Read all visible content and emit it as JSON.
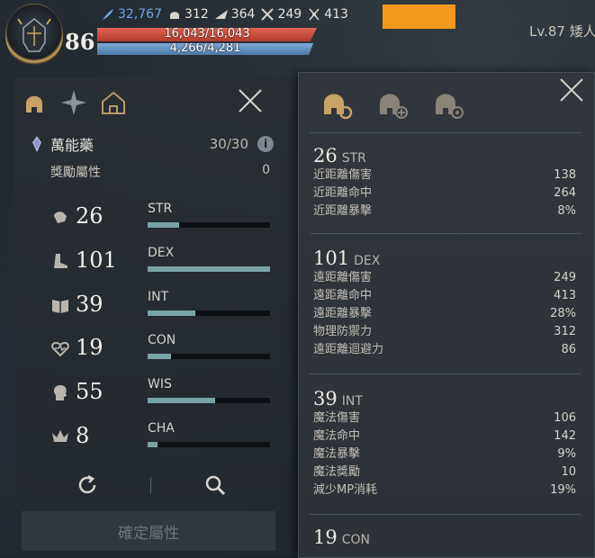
{
  "hud": {
    "level": "86",
    "stats": [
      {
        "icon": "feather-icon",
        "value": "32,767",
        "color": "#6fa8e8"
      },
      {
        "icon": "helmet-icon",
        "value": "312",
        "color": "#e8e4dc"
      },
      {
        "icon": "wing-icon",
        "value": "364",
        "color": "#e8e4dc"
      },
      {
        "icon": "crossed-swords-icon",
        "value": "249",
        "color": "#e8e4dc"
      },
      {
        "icon": "crossed-blades-icon",
        "value": "413",
        "color": "#e8e4dc"
      }
    ],
    "hp": "16,043/16,043",
    "mp": "4,266/4,281",
    "target_level": "Lv.87 矮人"
  },
  "left": {
    "potion": {
      "name": "萬能藥",
      "count": "30/30"
    },
    "bonus": {
      "label": "獎勵屬性",
      "value": "0"
    },
    "attributes": [
      {
        "key": "STR",
        "value": "26",
        "icon": "fist-icon",
        "fill": 0.26
      },
      {
        "key": "DEX",
        "value": "101",
        "icon": "boot-icon",
        "fill": 1.0
      },
      {
        "key": "INT",
        "value": "39",
        "icon": "book-icon",
        "fill": 0.39
      },
      {
        "key": "CON",
        "value": "19",
        "icon": "heart-icon",
        "fill": 0.19
      },
      {
        "key": "WIS",
        "value": "55",
        "icon": "head-icon",
        "fill": 0.55
      },
      {
        "key": "CHA",
        "value": "8",
        "icon": "crown-icon",
        "fill": 0.08
      }
    ],
    "confirm": "確定屬性"
  },
  "right": {
    "sections": [
      {
        "num": "26",
        "name": "STR",
        "rows": [
          {
            "label": "近距離傷害",
            "value": "138"
          },
          {
            "label": "近距離命中",
            "value": "264"
          },
          {
            "label": "近距離暴擊",
            "value": "8%"
          }
        ]
      },
      {
        "num": "101",
        "name": "DEX",
        "rows": [
          {
            "label": "遠距離傷害",
            "value": "249"
          },
          {
            "label": "遠距離命中",
            "value": "413"
          },
          {
            "label": "遠距離暴擊",
            "value": "28%"
          },
          {
            "label": "物理防禦力",
            "value": "312"
          },
          {
            "label": "遠距離迴避力",
            "value": "86"
          }
        ]
      },
      {
        "num": "39",
        "name": "INT",
        "rows": [
          {
            "label": "魔法傷害",
            "value": "106"
          },
          {
            "label": "魔法命中",
            "value": "142"
          },
          {
            "label": "魔法暴擊",
            "value": "9%"
          },
          {
            "label": "魔法獎勵",
            "value": "10"
          },
          {
            "label": "減少MP消耗",
            "value": "19%"
          }
        ]
      },
      {
        "num": "19",
        "name": "CON",
        "rows": []
      }
    ]
  }
}
